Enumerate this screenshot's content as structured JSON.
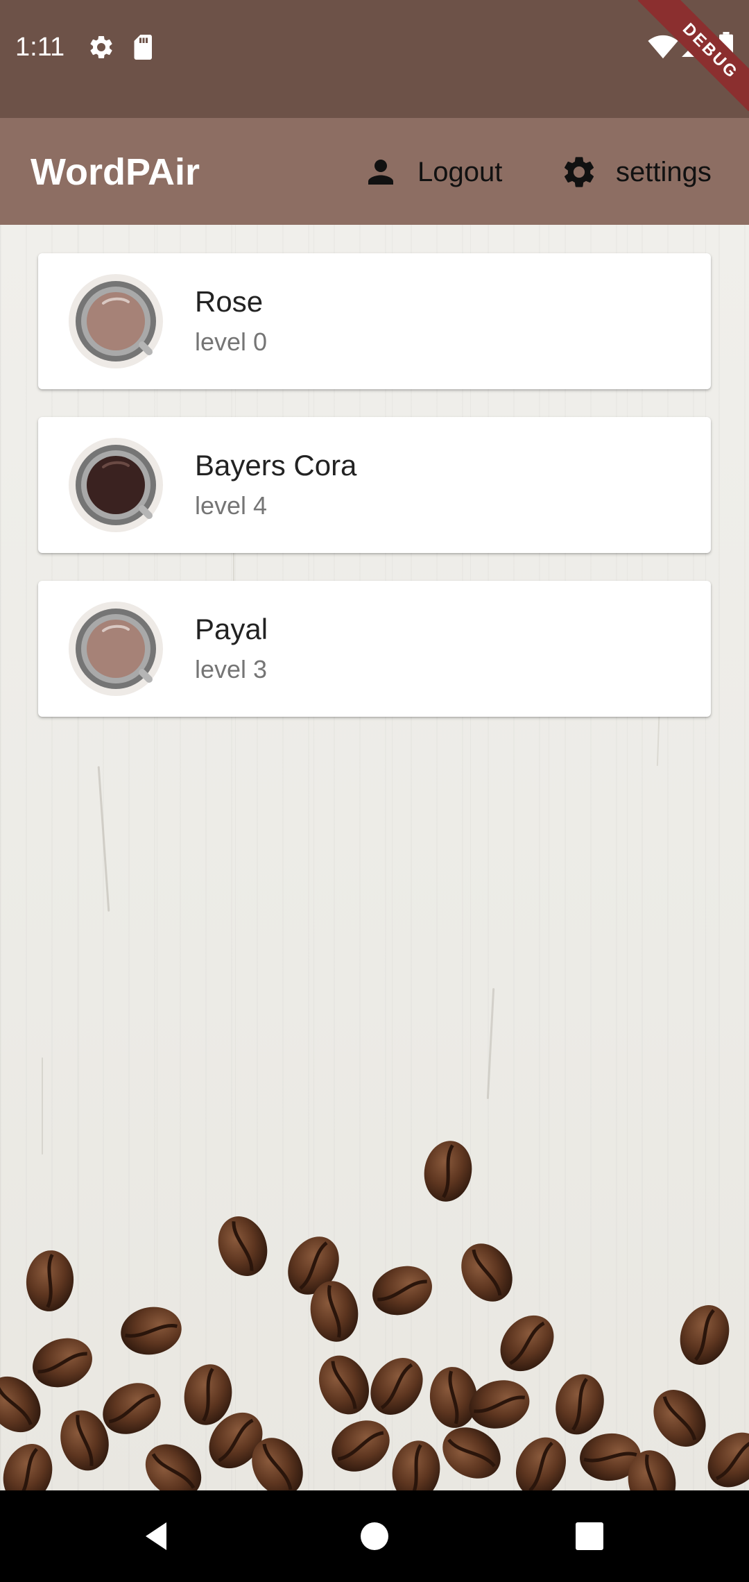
{
  "status_bar": {
    "time": "1:11",
    "icons": [
      "gear-icon",
      "sd-card-icon",
      "wifi-icon",
      "signal-icon",
      "battery-icon"
    ],
    "debug_banner": "DEBUG"
  },
  "app_bar": {
    "title": "WordPAir",
    "logout_label": "Logout",
    "logout_icon": "person-icon",
    "settings_label": "settings",
    "settings_icon": "gear-icon"
  },
  "users": [
    {
      "name": "Rose",
      "level": "level 0",
      "avatar": "light-coffee-cup",
      "cup_color": "#a68277"
    },
    {
      "name": "Bayers Cora",
      "level": "level 4",
      "avatar": "dark-coffee-cup",
      "cup_color": "#3a2220"
    },
    {
      "name": "Payal",
      "level": "level 3",
      "avatar": "light-coffee-cup",
      "cup_color": "#a68277"
    }
  ],
  "navigation": {
    "back_icon": "back-triangle-icon",
    "home_icon": "home-circle-icon",
    "recents_icon": "recents-square-icon"
  },
  "colors": {
    "status_bar": "#6d5248",
    "app_bar": "#8d6e63",
    "card": "#ffffff",
    "debug_ribbon": "#8b2f2f"
  }
}
